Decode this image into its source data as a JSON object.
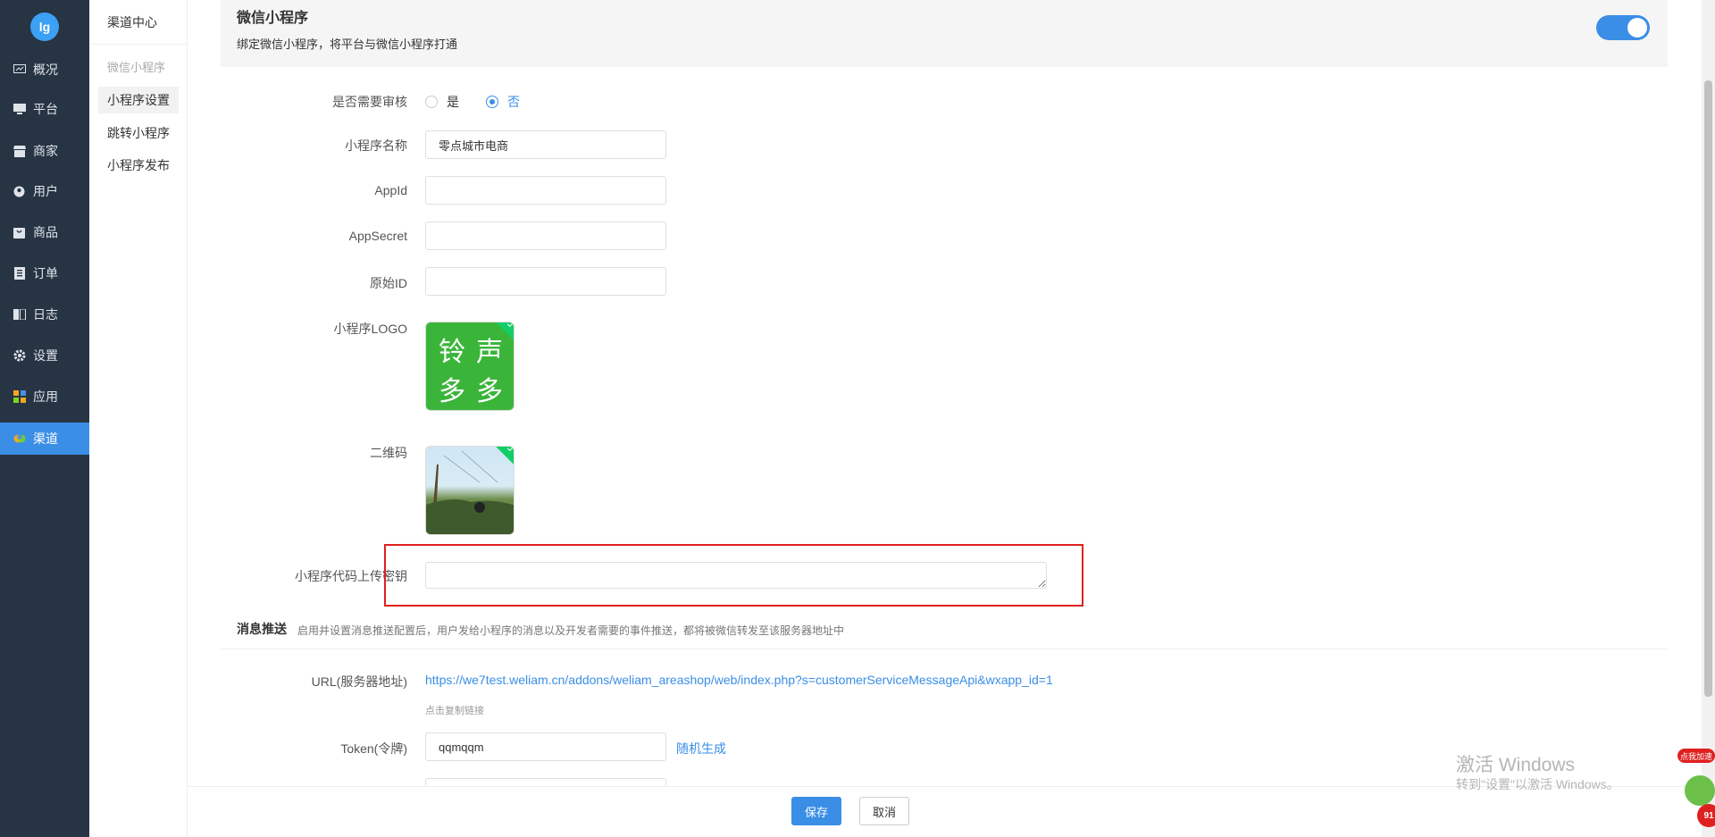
{
  "app": {
    "logo_text": "lg"
  },
  "sidebar": {
    "items": [
      {
        "label": "概况",
        "icon": "monitor-icon"
      },
      {
        "label": "平台",
        "icon": "desktop-icon"
      },
      {
        "label": "商家",
        "icon": "store-icon"
      },
      {
        "label": "用户",
        "icon": "user-icon"
      },
      {
        "label": "商品",
        "icon": "bag-icon"
      },
      {
        "label": "订单",
        "icon": "order-icon"
      },
      {
        "label": "日志",
        "icon": "book-icon"
      },
      {
        "label": "设置",
        "icon": "gear-icon"
      },
      {
        "label": "应用",
        "icon": "apps-grid-icon"
      },
      {
        "label": "渠道",
        "icon": "channel-icon",
        "active": true
      }
    ]
  },
  "subnav": {
    "title": "渠道中心",
    "group": "微信小程序",
    "items": [
      {
        "label": "小程序设置",
        "active": true
      },
      {
        "label": "跳转小程序"
      },
      {
        "label": "小程序发布"
      }
    ]
  },
  "panel": {
    "title": "微信小程序",
    "desc": "绑定微信小程序，将平台与微信小程序打通",
    "enabled": true
  },
  "form": {
    "review_label": "是否需要审核",
    "review_yes": "是",
    "review_no": "否",
    "name_label": "小程序名称",
    "name_value": "零点城市电商",
    "appid_label": "AppId",
    "appid_value": "",
    "appsecret_label": "AppSecret",
    "appsecret_value": "",
    "origin_id_label": "原始ID",
    "origin_id_value": "",
    "logo_label": "小程序LOGO",
    "logo_chars": [
      "铃",
      "声",
      "多",
      "多"
    ],
    "qrcode_label": "二维码",
    "upload_key_label": "小程序代码上传密钥",
    "upload_key_value": ""
  },
  "message": {
    "title": "消息推送",
    "desc": "启用并设置消息推送配置后，用户发给小程序的消息以及开发者需要的事件推送，都将被微信转发至该服务器地址中",
    "url_label": "URL(服务器地址)",
    "url_value": "https://we7test.weliam.cn/addons/weliam_areashop/web/index.php?s=customerServiceMessageApi&wxapp_id=1",
    "url_hint": "点击复制链接",
    "token_label": "Token(令牌)",
    "token_value": "qqmqqm",
    "token_random": "随机生成"
  },
  "footer": {
    "save": "保存",
    "cancel": "取消"
  },
  "watermark": {
    "title": "激活 Windows",
    "subtitle": "转到\"设置\"以激活 Windows。"
  },
  "corner_widget": {
    "tag": "点我加速",
    "number": "91"
  },
  "colors": {
    "primary": "#3a8ee6",
    "sidebar_bg": "#273444",
    "highlight": "#e02020",
    "success": "#13ce66"
  }
}
